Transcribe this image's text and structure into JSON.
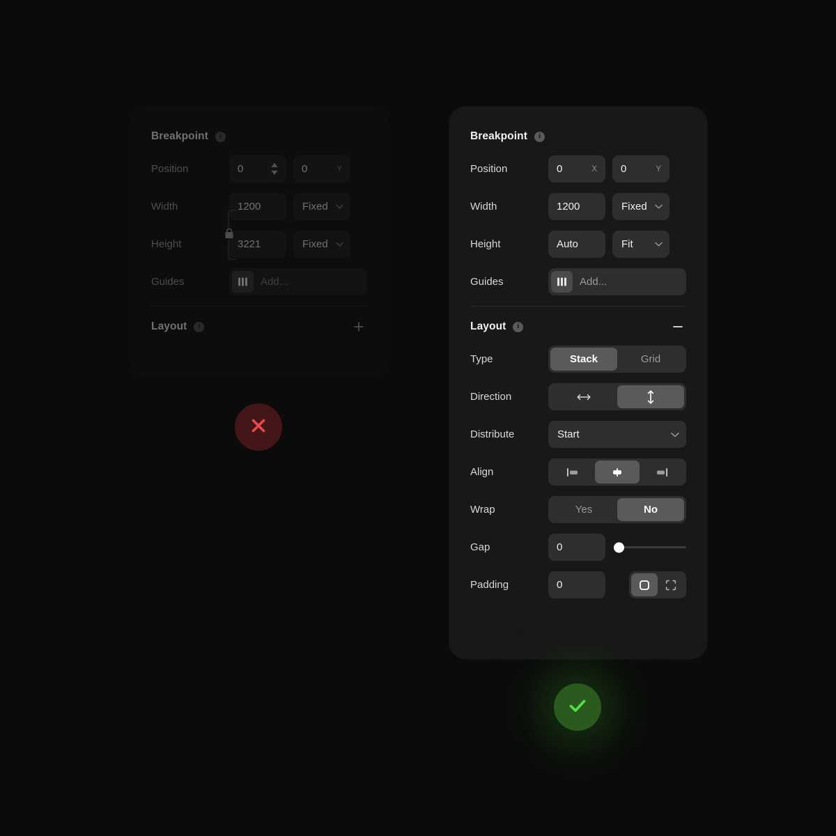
{
  "left_panel": {
    "state": "collapsed-dimmed",
    "breakpoint": {
      "title": "Breakpoint",
      "info_icon": "info-icon",
      "position": {
        "label": "Position",
        "x_value": "0",
        "x_suffix": "",
        "x_spinner_icon": "stepper-arrows-icon",
        "y_value": "0",
        "y_suffix": "Y"
      },
      "width": {
        "label": "Width",
        "value": "1200",
        "mode": "Fixed",
        "chevron": "chevron-down-icon"
      },
      "height": {
        "label": "Height",
        "value": "3221",
        "mode": "Fixed",
        "chevron": "chevron-down-icon"
      },
      "link_icon": "lock-open-icon",
      "guides": {
        "label": "Guides",
        "icon": "guides-columns-icon",
        "placeholder": "Add..."
      }
    },
    "layout": {
      "title": "Layout",
      "info_icon": "info-icon",
      "toggle_icon": "plus-icon",
      "expanded": false
    }
  },
  "right_panel": {
    "state": "expanded",
    "breakpoint": {
      "title": "Breakpoint",
      "info_icon": "info-icon",
      "position": {
        "label": "Position",
        "x_value": "0",
        "x_suffix": "X",
        "y_value": "0",
        "y_suffix": "Y"
      },
      "width": {
        "label": "Width",
        "value": "1200",
        "mode": "Fixed",
        "chevron": "chevron-down-icon"
      },
      "height": {
        "label": "Height",
        "value": "Auto",
        "mode": "Fit",
        "chevron": "chevron-down-icon"
      },
      "guides": {
        "label": "Guides",
        "icon": "guides-columns-icon",
        "placeholder": "Add..."
      }
    },
    "layout": {
      "title": "Layout",
      "info_icon": "info-icon",
      "toggle_icon": "minus-icon",
      "expanded": true,
      "type": {
        "label": "Type",
        "options": [
          "Stack",
          "Grid"
        ],
        "selected": "Stack"
      },
      "direction": {
        "label": "Direction",
        "options": [
          "horizontal-arrow-icon",
          "vertical-arrow-icon"
        ],
        "selected": "vertical-arrow-icon"
      },
      "distribute": {
        "label": "Distribute",
        "value": "Start",
        "chevron": "chevron-down-icon"
      },
      "align": {
        "label": "Align",
        "options": [
          "align-start-icon",
          "align-center-icon",
          "align-end-icon"
        ],
        "selected": "align-center-icon"
      },
      "wrap": {
        "label": "Wrap",
        "options": [
          "Yes",
          "No"
        ],
        "selected": "No"
      },
      "gap": {
        "label": "Gap",
        "value": "0",
        "slider_percent": 0
      },
      "padding": {
        "label": "Padding",
        "value": "0",
        "options": [
          "padding-uniform-icon",
          "padding-individual-icon"
        ],
        "selected": "padding-uniform-icon"
      }
    }
  },
  "status": {
    "reject": {
      "icon": "close-x-icon",
      "color": "#e8484a",
      "background": "#451617"
    },
    "accept": {
      "icon": "check-mark-icon",
      "color": "#55e04a",
      "background": "#2a5a1d"
    }
  },
  "colors": {
    "page_background": "#0b0b0b",
    "panel_dim": "#121212",
    "panel_bright": "#181818",
    "field_bright": "#2e2e2e",
    "field_dim": "#1e1e1e",
    "segment_active": "#5a5a5a"
  }
}
